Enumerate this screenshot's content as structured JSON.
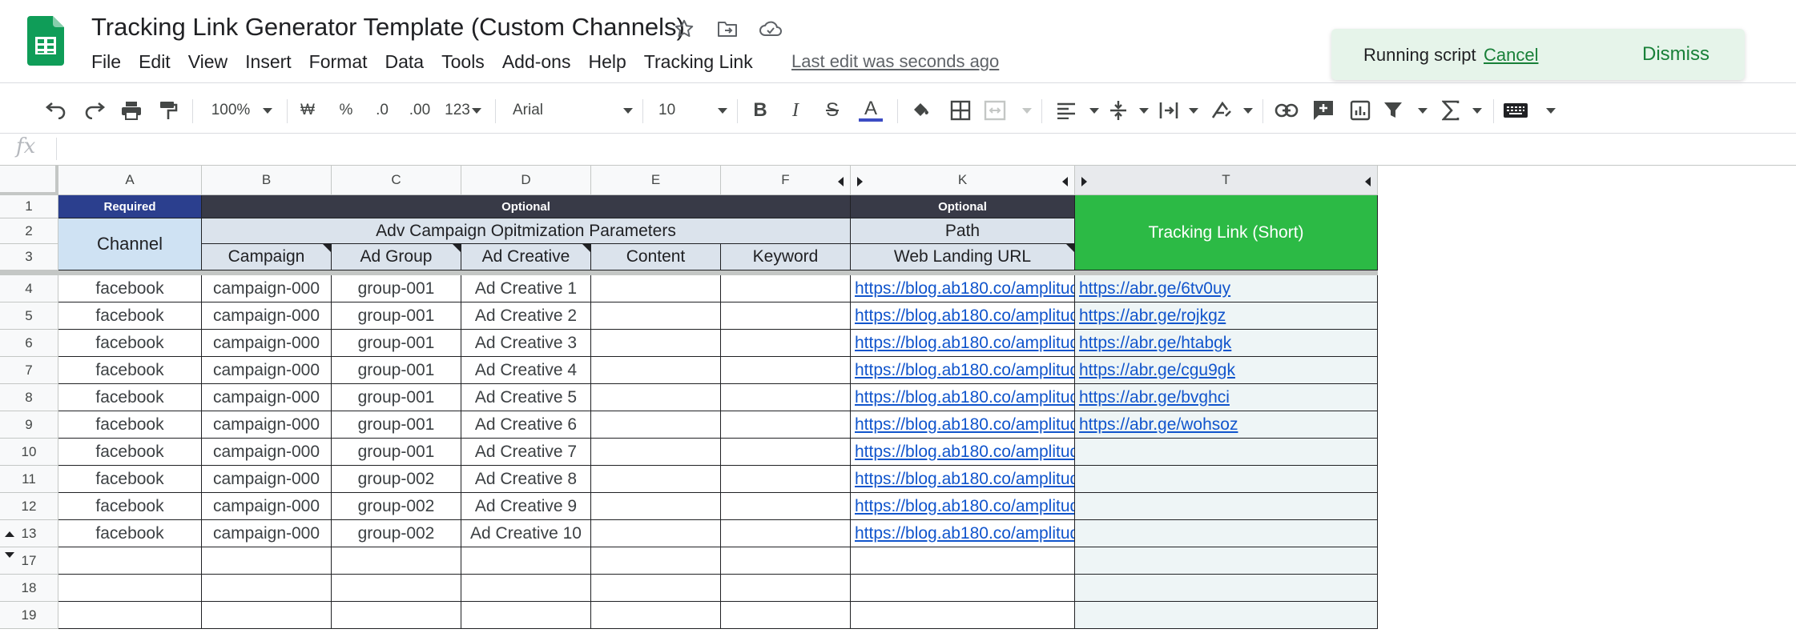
{
  "app": {
    "title": "Tracking Link Generator Template (Custom Channels)",
    "last_edit": "Last edit was seconds ago"
  },
  "menu": [
    "File",
    "Edit",
    "View",
    "Insert",
    "Format",
    "Data",
    "Tools",
    "Add-ons",
    "Help",
    "Tracking Link"
  ],
  "toast": {
    "text": "Running script",
    "cancel": "Cancel",
    "dismiss": "Dismiss"
  },
  "toolbar": {
    "zoom": "100%",
    "currency": "₩",
    "percent": "%",
    "dec_decrease": ".0",
    "dec_increase": ".00",
    "more_formats": "123",
    "font": "Arial",
    "font_size": "10",
    "bold": "B",
    "italic": "I",
    "strike": "S",
    "text_color": "A"
  },
  "formula_bar": {
    "fx": "fx",
    "value": ""
  },
  "columns": [
    "A",
    "B",
    "C",
    "D",
    "E",
    "F",
    "K",
    "T"
  ],
  "row_numbers": [
    "1",
    "2",
    "3",
    "4",
    "5",
    "6",
    "7",
    "8",
    "9",
    "10",
    "11",
    "12",
    "13",
    "17",
    "18",
    "19"
  ],
  "header": {
    "required": "Required",
    "optional_main": "Optional",
    "optional_path": "Optional",
    "channel": "Channel",
    "adv_params": "Adv Campaign Opitmization Parameters",
    "path": "Path",
    "tracking_link": "Tracking Link (Short)",
    "campaign": "Campaign",
    "ad_group": "Ad Group",
    "ad_creative": "Ad Creative",
    "content": "Content",
    "keyword": "Keyword",
    "web_landing_url": "Web Landing URL"
  },
  "rows": [
    {
      "channel": "facebook",
      "campaign": "campaign-000",
      "ad_group": "group-001",
      "ad_creative": "Ad Creative 1",
      "content": "",
      "keyword": "",
      "url": "https://blog.ab180.co/amplitud",
      "short": "https://abr.ge/6tv0uy"
    },
    {
      "channel": "facebook",
      "campaign": "campaign-000",
      "ad_group": "group-001",
      "ad_creative": "Ad Creative 2",
      "content": "",
      "keyword": "",
      "url": "https://blog.ab180.co/amplitud",
      "short": "https://abr.ge/rojkgz"
    },
    {
      "channel": "facebook",
      "campaign": "campaign-000",
      "ad_group": "group-001",
      "ad_creative": "Ad Creative 3",
      "content": "",
      "keyword": "",
      "url": "https://blog.ab180.co/amplitud",
      "short": "https://abr.ge/htabgk"
    },
    {
      "channel": "facebook",
      "campaign": "campaign-000",
      "ad_group": "group-001",
      "ad_creative": "Ad Creative 4",
      "content": "",
      "keyword": "",
      "url": "https://blog.ab180.co/amplitud",
      "short": "https://abr.ge/cgu9gk"
    },
    {
      "channel": "facebook",
      "campaign": "campaign-000",
      "ad_group": "group-001",
      "ad_creative": "Ad Creative 5",
      "content": "",
      "keyword": "",
      "url": "https://blog.ab180.co/amplitud",
      "short": "https://abr.ge/bvghci"
    },
    {
      "channel": "facebook",
      "campaign": "campaign-000",
      "ad_group": "group-001",
      "ad_creative": "Ad Creative 6",
      "content": "",
      "keyword": "",
      "url": "https://blog.ab180.co/amplitud",
      "short": "https://abr.ge/wohsoz"
    },
    {
      "channel": "facebook",
      "campaign": "campaign-000",
      "ad_group": "group-001",
      "ad_creative": "Ad Creative 7",
      "content": "",
      "keyword": "",
      "url": "https://blog.ab180.co/amplitud",
      "short": ""
    },
    {
      "channel": "facebook",
      "campaign": "campaign-000",
      "ad_group": "group-002",
      "ad_creative": "Ad Creative 8",
      "content": "",
      "keyword": "",
      "url": "https://blog.ab180.co/amplitud",
      "short": ""
    },
    {
      "channel": "facebook",
      "campaign": "campaign-000",
      "ad_group": "group-002",
      "ad_creative": "Ad Creative 9",
      "content": "",
      "keyword": "",
      "url": "https://blog.ab180.co/amplitud",
      "short": ""
    },
    {
      "channel": "facebook",
      "campaign": "campaign-000",
      "ad_group": "group-002",
      "ad_creative": "Ad Creative 10",
      "content": "",
      "keyword": "",
      "url": "https://blog.ab180.co/amplitud",
      "short": ""
    }
  ],
  "colors": {
    "required_header": "#2b3f8e",
    "optional_header": "#383a47",
    "light_header": "#dbe3ec",
    "channel_header": "#cfe2f3",
    "tracking_header": "#2cba45",
    "tracking_column": "#eef5f6",
    "link": "#1155cc",
    "toast_bg": "#e6f4ea",
    "toast_action": "#188038"
  }
}
